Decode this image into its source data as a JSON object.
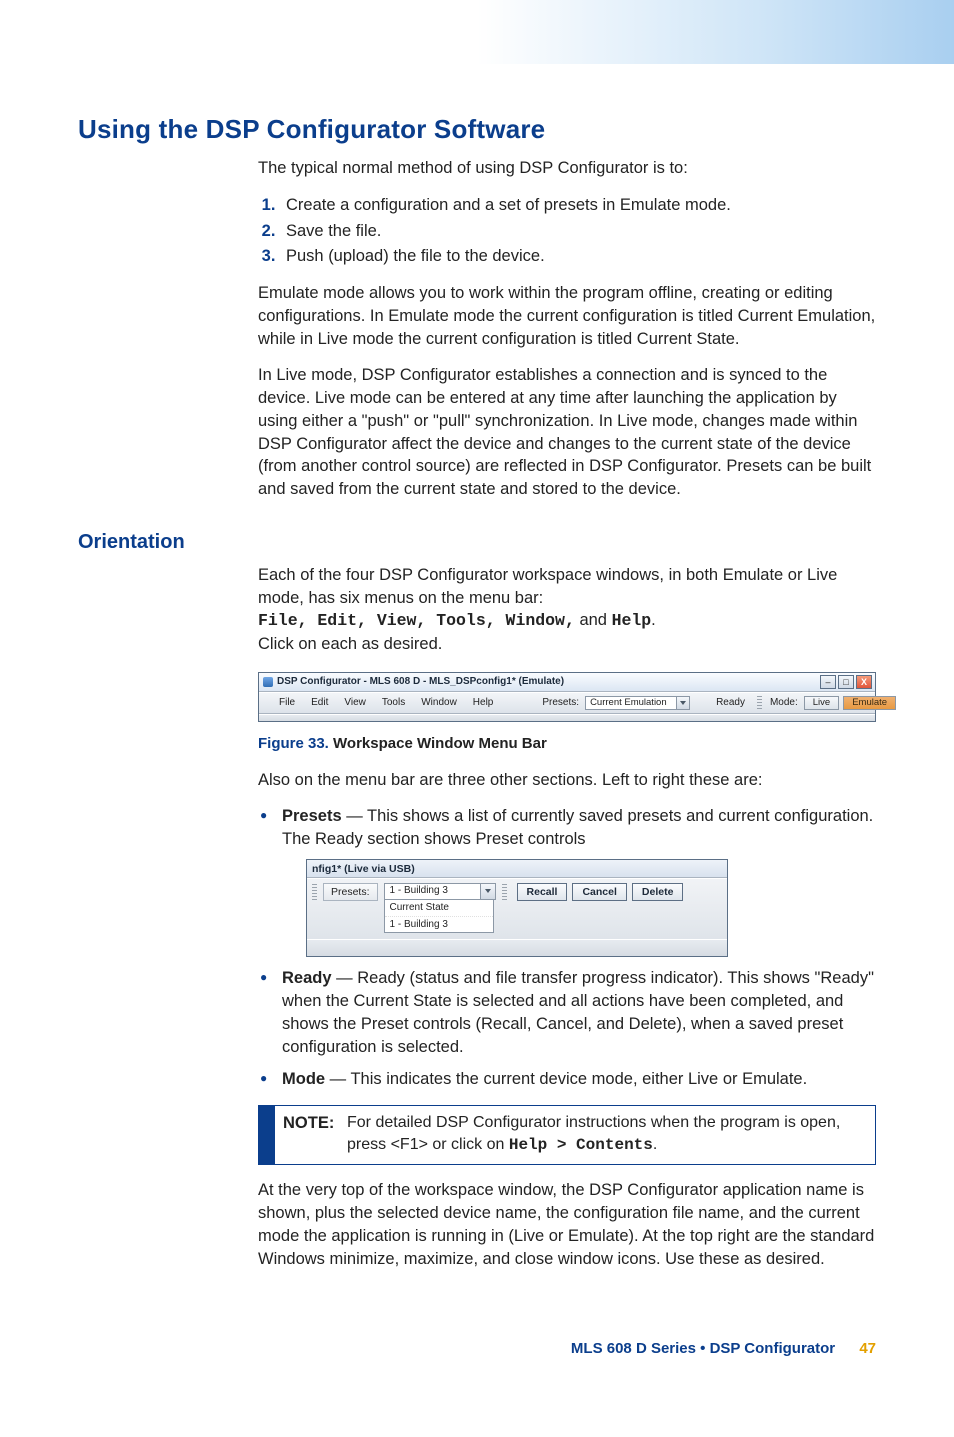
{
  "title": "Using the DSP Configurator Software",
  "intro": "The typical normal method of using DSP Configurator is to:",
  "steps": [
    "Create a configuration and a set of presets in Emulate mode.",
    "Save the file.",
    "Push (upload) the file to the device."
  ],
  "para_emulate": "Emulate mode allows you to work within the program offline, creating or editing configurations. In Emulate mode the current configuration is titled Current Emulation, while in Live mode the current configuration is titled Current State.",
  "para_live": "In Live mode, DSP Configurator establishes a connection and is synced to the device. Live mode can be entered at any time after launching the application by using either a \"push\" or \"pull\" synchronization. In Live mode, changes made within DSP Configurator affect the device and changes to the current state of the device (from another control source) are reflected in DSP Configurator. Presets can be built and saved from the current state and stored to the device.",
  "orientation": {
    "title": "Orientation",
    "p1": "Each of the four DSP Configurator workspace windows, in both Emulate or Live mode, has six menus on the menu bar:",
    "menus_mono": "File, Edit, View, Tools, Window,",
    "menus_and": " and ",
    "menus_help": "Help",
    "p1b": ".",
    "p1c": "Click on each as desired.",
    "fig33": {
      "num": "Figure 33.",
      "title": "Workspace Window Menu Bar",
      "window_title": "DSP Configurator - MLS 608 D - MLS_DSPconfig1* (Emulate)",
      "menus": [
        "File",
        "Edit",
        "View",
        "Tools",
        "Window",
        "Help"
      ],
      "presets_label": "Presets:",
      "preset_value": "Current Emulation",
      "ready": "Ready",
      "mode_label": "Mode:",
      "mode_live": "Live",
      "mode_emulate": "Emulate",
      "win_min": "–",
      "win_max": "□",
      "win_close": "X"
    },
    "p2": "Also on the menu bar are three other sections. Left to right these are:",
    "bullets": {
      "presets_term": "Presets",
      "presets_text": " — This shows a list of currently saved presets and current configuration. The Ready section shows Preset controls",
      "ready_term": "Ready",
      "ready_text": " — Ready (status and file transfer progress indicator). This shows \"Ready\" when the Current State is selected and all actions have been completed, and shows the Preset controls (Recall, Cancel, and Delete), when a saved preset configuration is selected.",
      "mode_term": "Mode",
      "mode_text": " — This indicates the current device mode, either Live or Emulate."
    },
    "presets_detail": {
      "title": "nfig1* (Live via USB)",
      "label": "Presets:",
      "value": "1 - Building 3",
      "options": [
        "Current State",
        "1 - Building 3"
      ],
      "btn_recall": "Recall",
      "btn_cancel": "Cancel",
      "btn_delete": "Delete"
    },
    "note": {
      "label": "NOTE:",
      "t1": "For detailed DSP Configurator instructions when the program is open, press <F1> or click on ",
      "mono": "Help > Contents",
      "t2": "."
    },
    "p3": "At the very top of the workspace window, the DSP Configurator application name is shown, plus the selected device name, the configuration file name, and the current mode the application is running in (Live or Emulate). At the top right are the standard Windows minimize, maximize, and close window icons. Use these as desired."
  },
  "footer": {
    "doc": "MLS 608 D Series • DSP Configurator",
    "page": "47"
  }
}
